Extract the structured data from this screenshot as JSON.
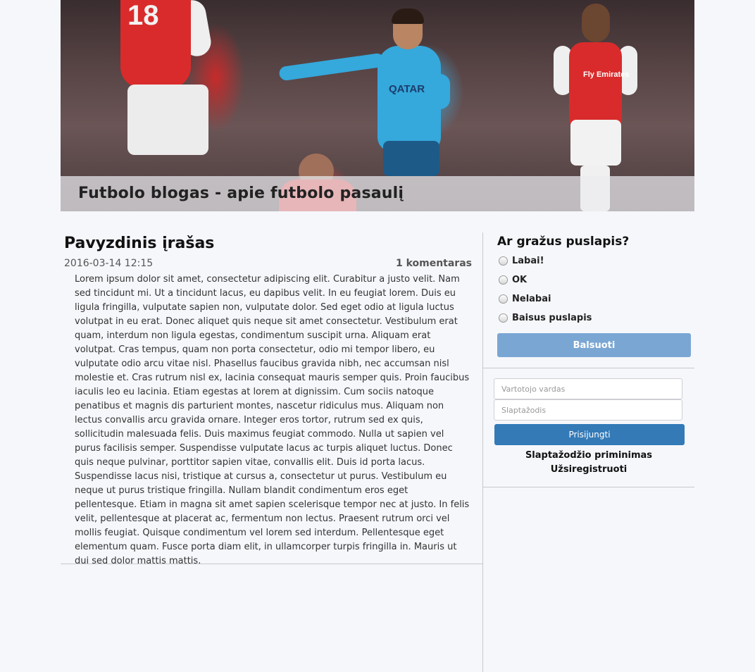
{
  "header": {
    "title": "Futbolo blogas - apie futbolo pasaulį",
    "banner_image": "football-players-photo",
    "player_number": "18",
    "jersey_sponsor_blue": "QATAR",
    "jersey_sponsor_red": "Fly Emirates"
  },
  "post": {
    "title": "Pavyzdinis įrašas",
    "date": "2016-03-14 12:15",
    "comments": "1 komentaras",
    "body": "Lorem ipsum dolor sit amet, consectetur adipiscing elit. Curabitur a justo velit. Nam sed tincidunt mi. Ut a tincidunt lacus, eu dapibus velit. In eu feugiat lorem. Duis eu ligula fringilla, vulputate sapien non, vulputate dolor. Sed eget odio at ligula luctus volutpat in eu erat. Donec aliquet quis neque sit amet consectetur. Vestibulum erat quam, interdum non ligula egestas, condimentum suscipit urna. Aliquam erat volutpat. Cras tempus, quam non porta consectetur, odio mi tempor libero, eu vulputate odio arcu vitae nisl. Phasellus faucibus gravida nibh, nec accumsan nisl molestie et. Cras rutrum nisl ex, lacinia consequat mauris semper quis. Proin faucibus iaculis leo eu lacinia. Etiam egestas at lorem at dignissim. Cum sociis natoque penatibus et magnis dis parturient montes, nascetur ridiculus mus. Aliquam non lectus convallis arcu gravida ornare. Integer eros tortor, rutrum sed ex quis, sollicitudin malesuada felis. Duis maximus feugiat commodo. Nulla ut sapien vel purus facilisis semper. Suspendisse vulputate lacus ac turpis aliquet luctus. Donec quis neque pulvinar, porttitor sapien vitae, convallis elit. Duis id porta lacus. Suspendisse lacus nisi, tristique at cursus a, consectetur ut purus. Vestibulum eu neque ut purus tristique fringilla. Nullam blandit condimentum eros eget pellentesque. Etiam in magna sit amet sapien scelerisque tempor nec at justo. In felis velit, pellentesque at placerat ac, fermentum non lectus. Praesent rutrum orci vel mollis feugiat. Quisque condimentum vel lorem sed interdum. Pellentesque eget elementum quam. Fusce porta diam elit, in ullamcorper turpis fringilla in. Mauris ut dui sed dolor mattis mattis."
  },
  "poll": {
    "question": "Ar gražus puslapis?",
    "options": [
      "Labai!",
      "OK",
      "Nelabai",
      "Baisus puslapis"
    ],
    "vote_label": "Balsuoti",
    "vote_color": "#7aa6d3"
  },
  "login": {
    "username_placeholder": "Vartotojo vardas",
    "password_placeholder": "Slaptažodis",
    "login_label": "Prisijungti",
    "login_color": "#337ab7",
    "forgot_password": "Slaptažodžio priminimas",
    "register": "Užsiregistruoti"
  }
}
